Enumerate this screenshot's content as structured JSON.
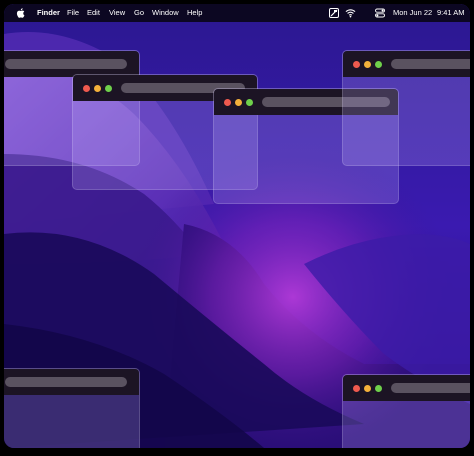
{
  "menubar": {
    "app_name": "Finder",
    "menus": [
      "File",
      "Edit",
      "View",
      "Go",
      "Window",
      "Help"
    ],
    "date": "Mon Jun 22",
    "time": "9:41 AM",
    "icons": [
      "apple-logo-icon",
      "screen-mirror-icon",
      "wifi-icon",
      "control-center-icon"
    ]
  },
  "windows": [
    {
      "name": "window-top-left",
      "traffic_lights": false
    },
    {
      "name": "window-center-left",
      "traffic_lights": true
    },
    {
      "name": "window-center",
      "traffic_lights": true
    },
    {
      "name": "window-top-right",
      "traffic_lights": true
    },
    {
      "name": "window-bottom-left",
      "traffic_lights": false
    },
    {
      "name": "window-bottom-right",
      "traffic_lights": true
    }
  ],
  "colors": {
    "red": "#ef5a4f",
    "yellow": "#f3b13b",
    "green": "#6fd04b",
    "titlebar": "#1c1424"
  }
}
